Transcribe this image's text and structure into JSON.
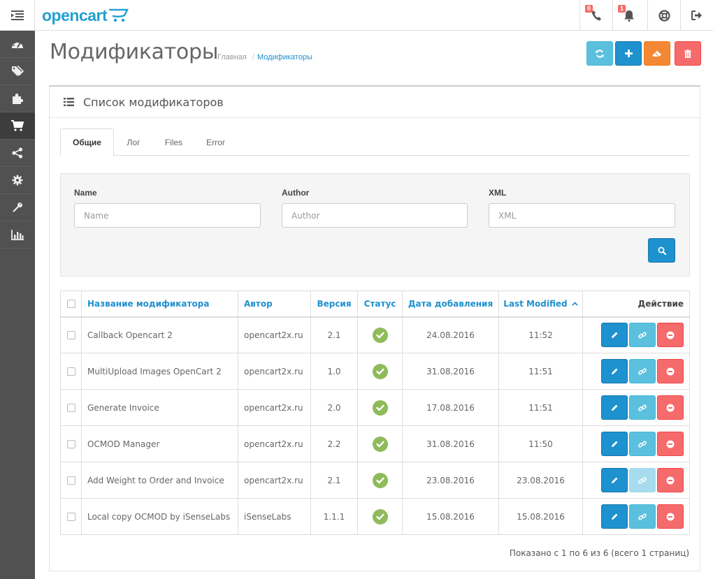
{
  "header": {
    "logo_text": "opencart",
    "phone_badge": "0",
    "bell_badge": "1"
  },
  "sidebar": {
    "items": [
      {
        "icon": "dashboard-icon"
      },
      {
        "icon": "tags-icon"
      },
      {
        "icon": "puzzle-icon"
      },
      {
        "icon": "shopping-cart-icon",
        "active": true
      },
      {
        "icon": "share-icon"
      },
      {
        "icon": "cog-icon"
      },
      {
        "icon": "wrench-icon"
      },
      {
        "icon": "bar-chart-icon"
      }
    ]
  },
  "page": {
    "title": "Модификаторы",
    "breadcrumb": [
      "Главная",
      "Модификаторы"
    ]
  },
  "panel": {
    "title": "Список модификаторов"
  },
  "tabs": [
    "Общие",
    "Лог",
    "Files",
    "Error"
  ],
  "filter": {
    "name_label": "Name",
    "name_placeholder": "Name",
    "author_label": "Author",
    "author_placeholder": "Author",
    "xml_label": "XML",
    "xml_placeholder": "XML"
  },
  "table": {
    "headers": {
      "name": "Название модификатора",
      "author": "Автор",
      "version": "Версия",
      "status": "Статус",
      "date_added": "Дата добавления",
      "last_modified": "Last Modified",
      "action": "Действие"
    },
    "rows": [
      {
        "name": "Callback Opencart 2",
        "author": "opencart2x.ru",
        "version": "2.1",
        "status": "enabled",
        "date_added": "24.08.2016",
        "last_modified": "11:52"
      },
      {
        "name": "MultiUpload Images OpenCart 2",
        "author": "opencart2x.ru",
        "version": "1.0",
        "status": "enabled",
        "date_added": "31.08.2016",
        "last_modified": "11:51"
      },
      {
        "name": "Generate Invoice",
        "author": "opencart2x.ru",
        "version": "2.0",
        "status": "enabled",
        "date_added": "17.08.2016",
        "last_modified": "11:51"
      },
      {
        "name": "OCMOD Manager",
        "author": "opencart2x.ru",
        "version": "2.2",
        "status": "enabled",
        "date_added": "31.08.2016",
        "last_modified": "11:50"
      },
      {
        "name": "Add Weight to Order and Invoice",
        "author": "opencart2x.ru",
        "version": "2.1",
        "status": "enabled",
        "date_added": "23.08.2016",
        "last_modified": "23.08.2016",
        "link_disabled": true
      },
      {
        "name": "Local copy OCMOD by iSenseLabs",
        "author": "iSenseLabs",
        "version": "1.1.1",
        "status": "enabled",
        "date_added": "15.08.2016",
        "last_modified": "15.08.2016"
      }
    ]
  },
  "pagination": {
    "text": "Показано с 1 по 6 из 6 (всего 1 страниц)"
  },
  "colors": {
    "primary": "#1e91cf",
    "info": "#5bc0de",
    "warning": "#f38733",
    "danger": "#f56b6b",
    "success": "#8fbb5a",
    "sidebar": "#515151"
  }
}
